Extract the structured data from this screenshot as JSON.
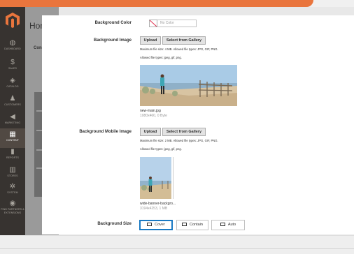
{
  "background": {
    "title": "Hom",
    "subtitle": "Con"
  },
  "sidebar": {
    "items": [
      {
        "icon": "dashboard-icon",
        "glyph": "◍",
        "label": "Dashboard"
      },
      {
        "icon": "sales-icon",
        "glyph": "$",
        "label": "Sales"
      },
      {
        "icon": "catalog-icon",
        "glyph": "◈",
        "label": "Catalog"
      },
      {
        "icon": "customers-icon",
        "glyph": "♟",
        "label": "Customers"
      },
      {
        "icon": "marketing-icon",
        "glyph": "◀",
        "label": "Marketing"
      },
      {
        "icon": "content-icon",
        "glyph": "▦",
        "label": "Content"
      },
      {
        "icon": "reports-icon",
        "glyph": "▮",
        "label": "Reports"
      },
      {
        "icon": "stores-icon",
        "glyph": "▥",
        "label": "Stores"
      },
      {
        "icon": "system-icon",
        "glyph": "✲",
        "label": "System"
      },
      {
        "icon": "extensions-icon",
        "glyph": "◉",
        "label": "Find Partners & Extensions"
      }
    ]
  },
  "modal": {
    "background_color": {
      "label": "Background Color",
      "placeholder": "No Color"
    },
    "background_image": {
      "label": "Background Image",
      "upload_label": "Upload",
      "gallery_label": "Select from Gallery",
      "max_note": "Maximum file size: 4 MB. Allowed file types: JPG, GIF, PNG.",
      "allowed_note": "Allowed file types: jpeg, gif, png.",
      "file_name": "new-main.jpg",
      "file_meta": "1080x460, 0 Byte"
    },
    "background_mobile_image": {
      "label": "Background Mobile Image",
      "upload_label": "Upload",
      "gallery_label": "Select from Gallery",
      "max_note": "Maximum file size: 2 MB. Allowed file types: JPG, GIF, PNG.",
      "allowed_note": "Allowed file types: jpeg, gif, png.",
      "file_name": "wide-banner-backgro...",
      "file_meta": "3194x4253, 1 MB"
    },
    "background_size": {
      "label": "Background Size",
      "options": [
        "Cover",
        "Contain",
        "Auto"
      ],
      "selected": "Cover"
    }
  },
  "colors": {
    "sidebar": "#373330",
    "accent": "#e9753d",
    "selected_border": "#1979c3"
  }
}
